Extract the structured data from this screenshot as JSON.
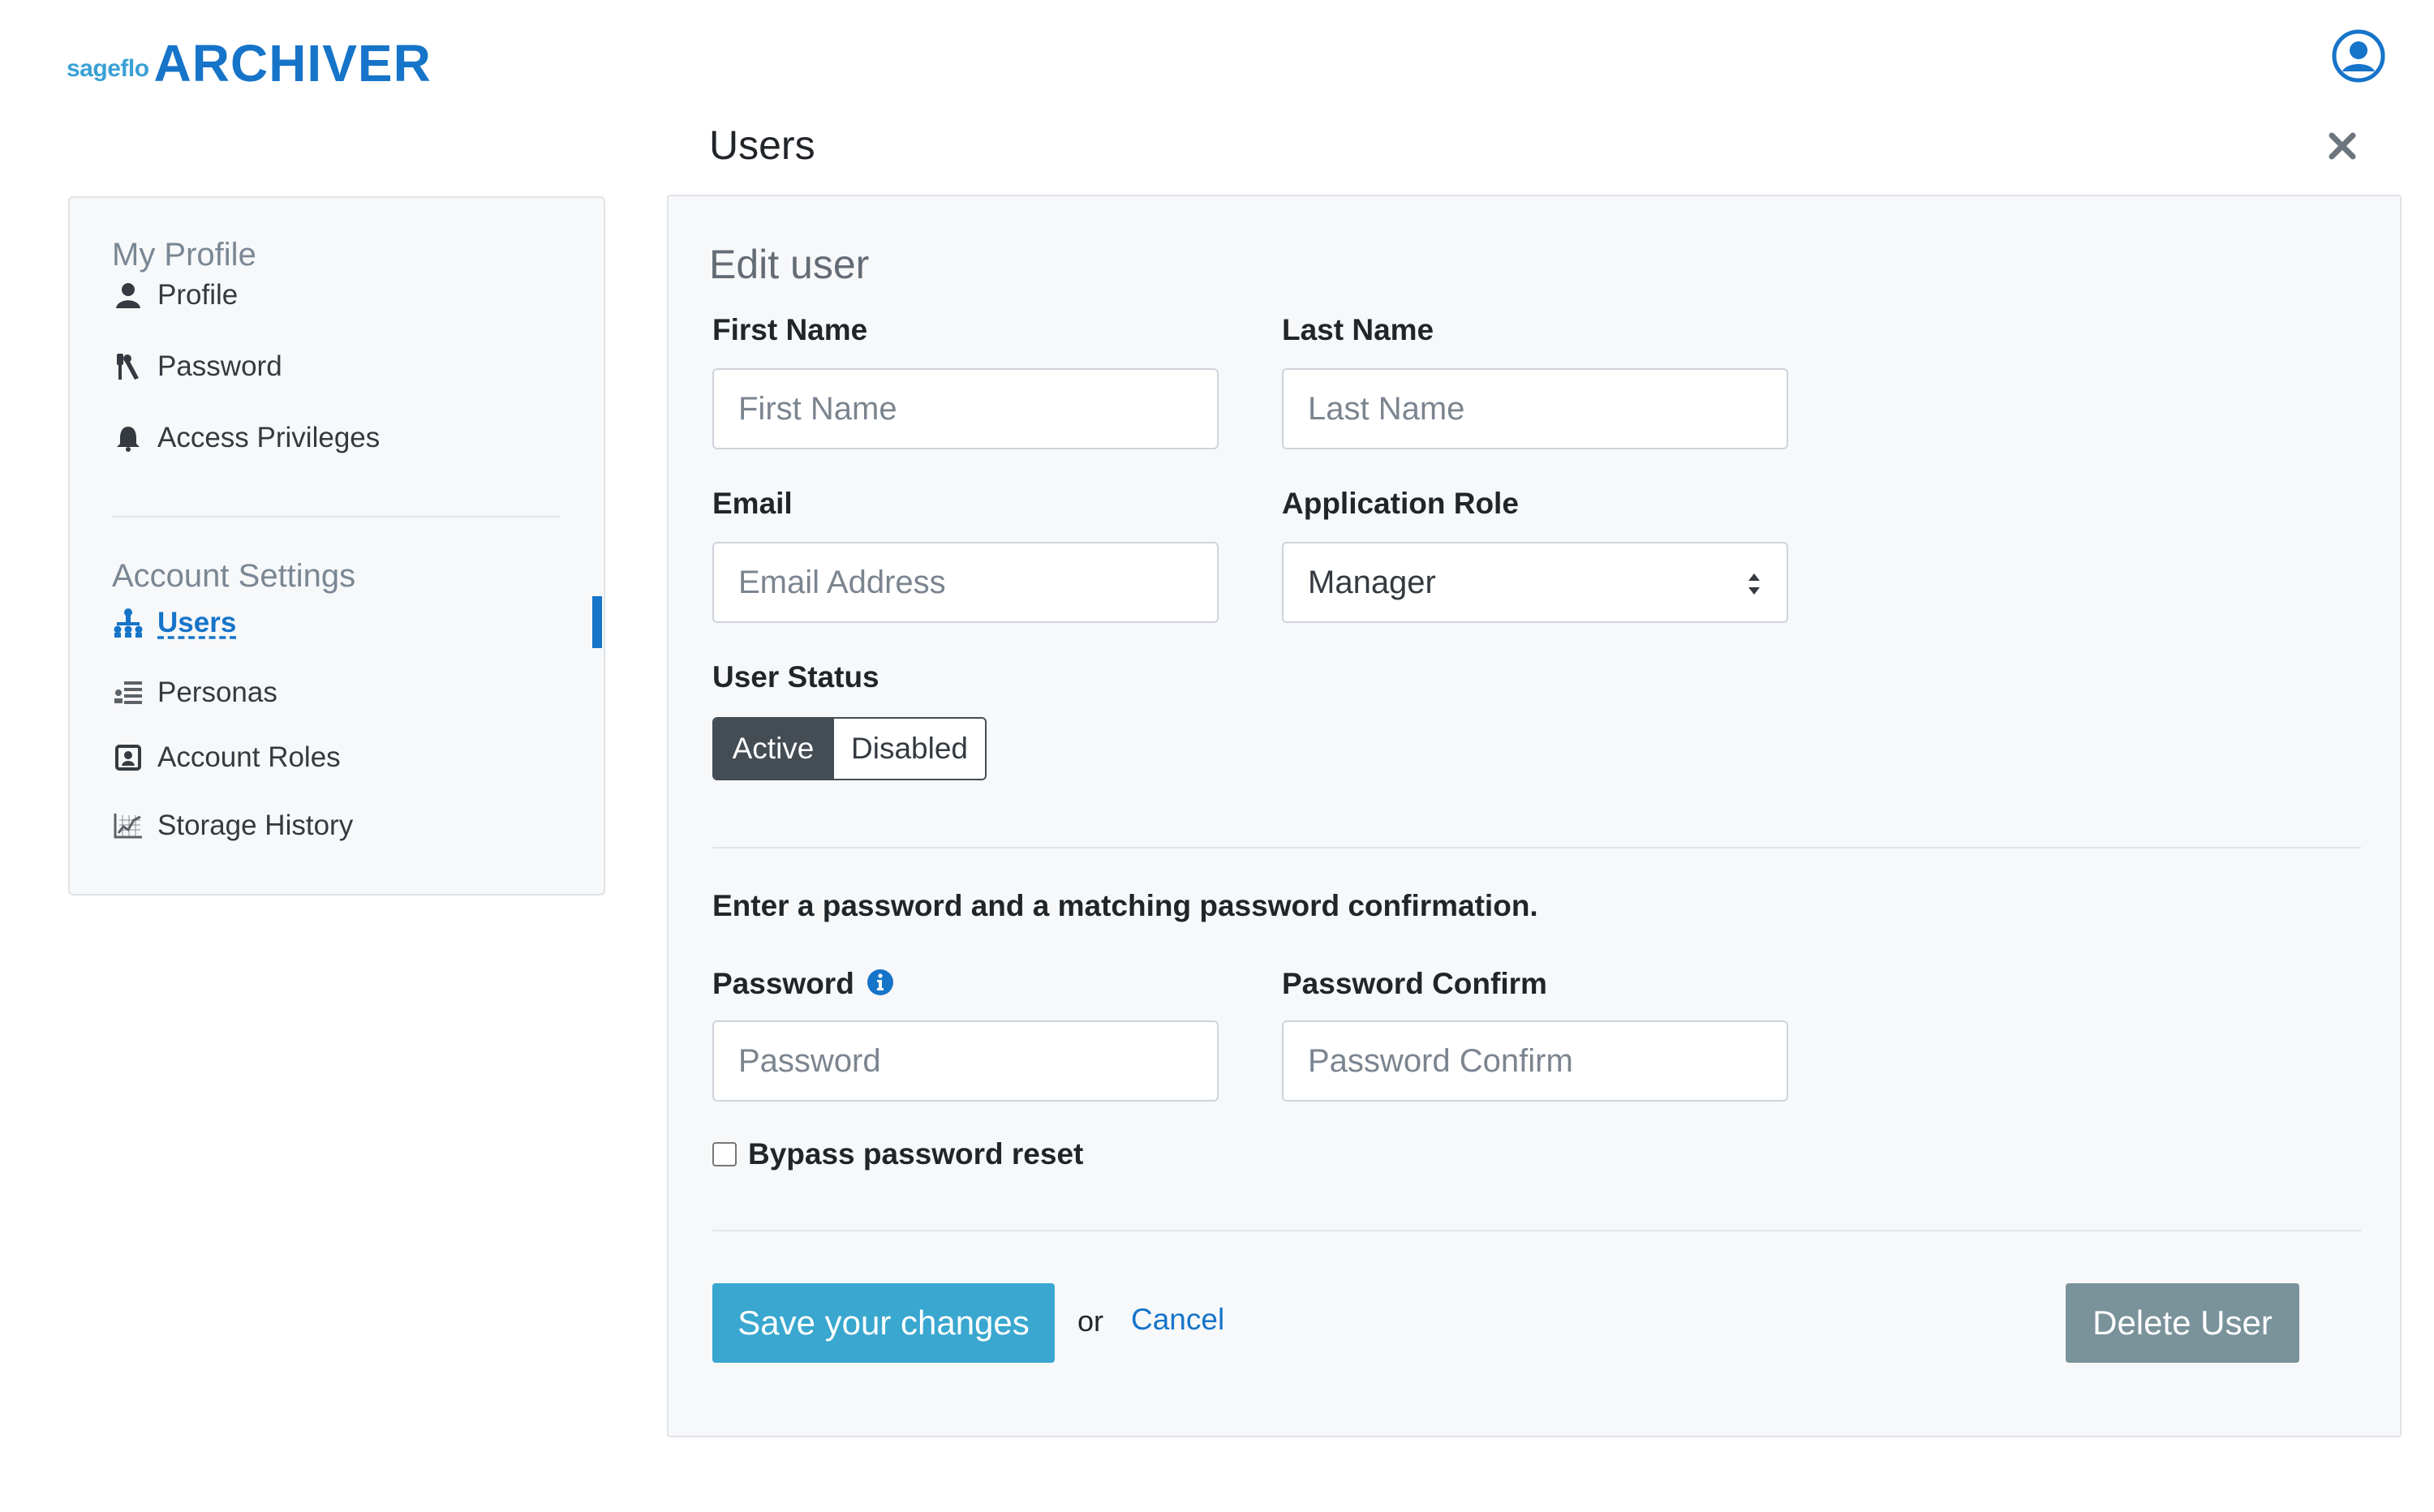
{
  "header": {
    "logo_small": "sageflo",
    "logo_big": "ARCHIVER",
    "page_title": "Users"
  },
  "sidebar": {
    "section_profile": "My Profile",
    "profile_items": [
      {
        "label": "Profile",
        "icon": "user-icon"
      },
      {
        "label": "Password",
        "icon": "key-icon"
      },
      {
        "label": "Access Privileges",
        "icon": "bell-icon"
      }
    ],
    "section_account": "Account Settings",
    "account_items": [
      {
        "label": "Users",
        "icon": "org-chart-icon",
        "active": true
      },
      {
        "label": "Personas",
        "icon": "persona-list-icon"
      },
      {
        "label": "Account Roles",
        "icon": "id-card-icon"
      },
      {
        "label": "Storage History",
        "icon": "chart-icon"
      }
    ]
  },
  "form": {
    "title": "Edit user",
    "first_name": {
      "label": "First Name",
      "placeholder": "First Name",
      "value": ""
    },
    "last_name": {
      "label": "Last Name",
      "placeholder": "Last Name",
      "value": ""
    },
    "email": {
      "label": "Email",
      "placeholder": "Email Address",
      "value": ""
    },
    "role": {
      "label": "Application Role",
      "value": "Manager"
    },
    "status": {
      "label": "User Status",
      "active_label": "Active",
      "disabled_label": "Disabled",
      "selected": "Active"
    },
    "password_note": "Enter a password and a matching password confirmation.",
    "password": {
      "label": "Password",
      "placeholder": "Password",
      "value": ""
    },
    "password_confirm": {
      "label": "Password Confirm",
      "placeholder": "Password Confirm",
      "value": ""
    },
    "bypass": {
      "label": "Bypass password reset",
      "checked": false
    },
    "save_label": "Save your changes",
    "or_text": "or",
    "cancel_label": "Cancel",
    "delete_label": "Delete User"
  },
  "colors": {
    "brand": "#1674c9",
    "brand_light": "#3aa0d5",
    "save_button": "#39a7cf",
    "delete_button": "#7a929a",
    "toggle_active": "#444c54"
  }
}
